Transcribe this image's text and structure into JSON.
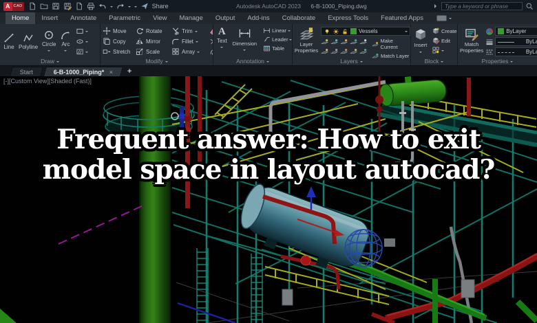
{
  "title_bar": {
    "app_badge": "A",
    "app_badge_sub": "CAD",
    "share_label": "Share",
    "app_title": "Autodesk AutoCAD 2023",
    "document_name": "6-B-1000_Piping.dwg",
    "search_placeholder": "Type a keyword or phrase",
    "qat_icons": [
      "new-file",
      "open-file",
      "save",
      "save-as",
      "plot",
      "print",
      "undo",
      "redo",
      "qat-customize",
      "share"
    ]
  },
  "ribbon": {
    "tabs": [
      "Home",
      "Insert",
      "Annotate",
      "Parametric",
      "View",
      "Manage",
      "Output",
      "Add-ins",
      "Collaborate",
      "Express Tools",
      "Featured Apps"
    ],
    "active_tab": "Home",
    "panels": {
      "draw": {
        "label": "Draw",
        "items": [
          "Line",
          "Polyline",
          "Circle",
          "Arc"
        ]
      },
      "modify": {
        "label": "Modify",
        "rows": [
          [
            "Move",
            "Rotate",
            "Trim"
          ],
          [
            "Copy",
            "Mirror",
            "Fillet"
          ],
          [
            "Stretch",
            "Scale",
            "Array"
          ]
        ]
      },
      "annotation": {
        "label": "Annotation",
        "text_tool": "Text",
        "text_icon_glyph": "A",
        "dimension_tool": "Dimension",
        "column": [
          "Linear",
          "Leader",
          "Table"
        ]
      },
      "layers": {
        "label": "Layers",
        "properties_button": "Layer Properties",
        "layer_combo_value": "Vessels",
        "make_current": "Make Current",
        "match_layer": "Match Layer"
      },
      "block": {
        "label": "Block",
        "insert": "Insert",
        "create": "Create",
        "edit": "Edit"
      },
      "properties": {
        "label": "Properties",
        "match_button": "Match Properties",
        "color_value": "ByLayer",
        "lineweight_value": "ByLayer",
        "linetype_value": "ByLayer"
      }
    }
  },
  "file_tabs": {
    "start_tab": "Start",
    "active_tab": "6-B-1000_Piping*",
    "close_glyph": "×",
    "new_tab_glyph": "+"
  },
  "viewport": {
    "controls": "[-][Custom View][Shaded (Fast)]"
  },
  "overlay": {
    "line1": "Frequent answer: How to exit",
    "line2": "model space in layout autocad?"
  },
  "colors": {
    "background": "#000000",
    "ribbon": "#262c34",
    "titlebar": "#151b22",
    "accent_red_badge": "#c8232f",
    "layer_swatch": "#33a02c",
    "teal_structure": "#17897a",
    "yellow_structure": "#c3ca1e",
    "green_vessel": "#2f9c1a",
    "cyan_vessel": "#5fa3b4",
    "overlay_text": "#ffffff"
  }
}
